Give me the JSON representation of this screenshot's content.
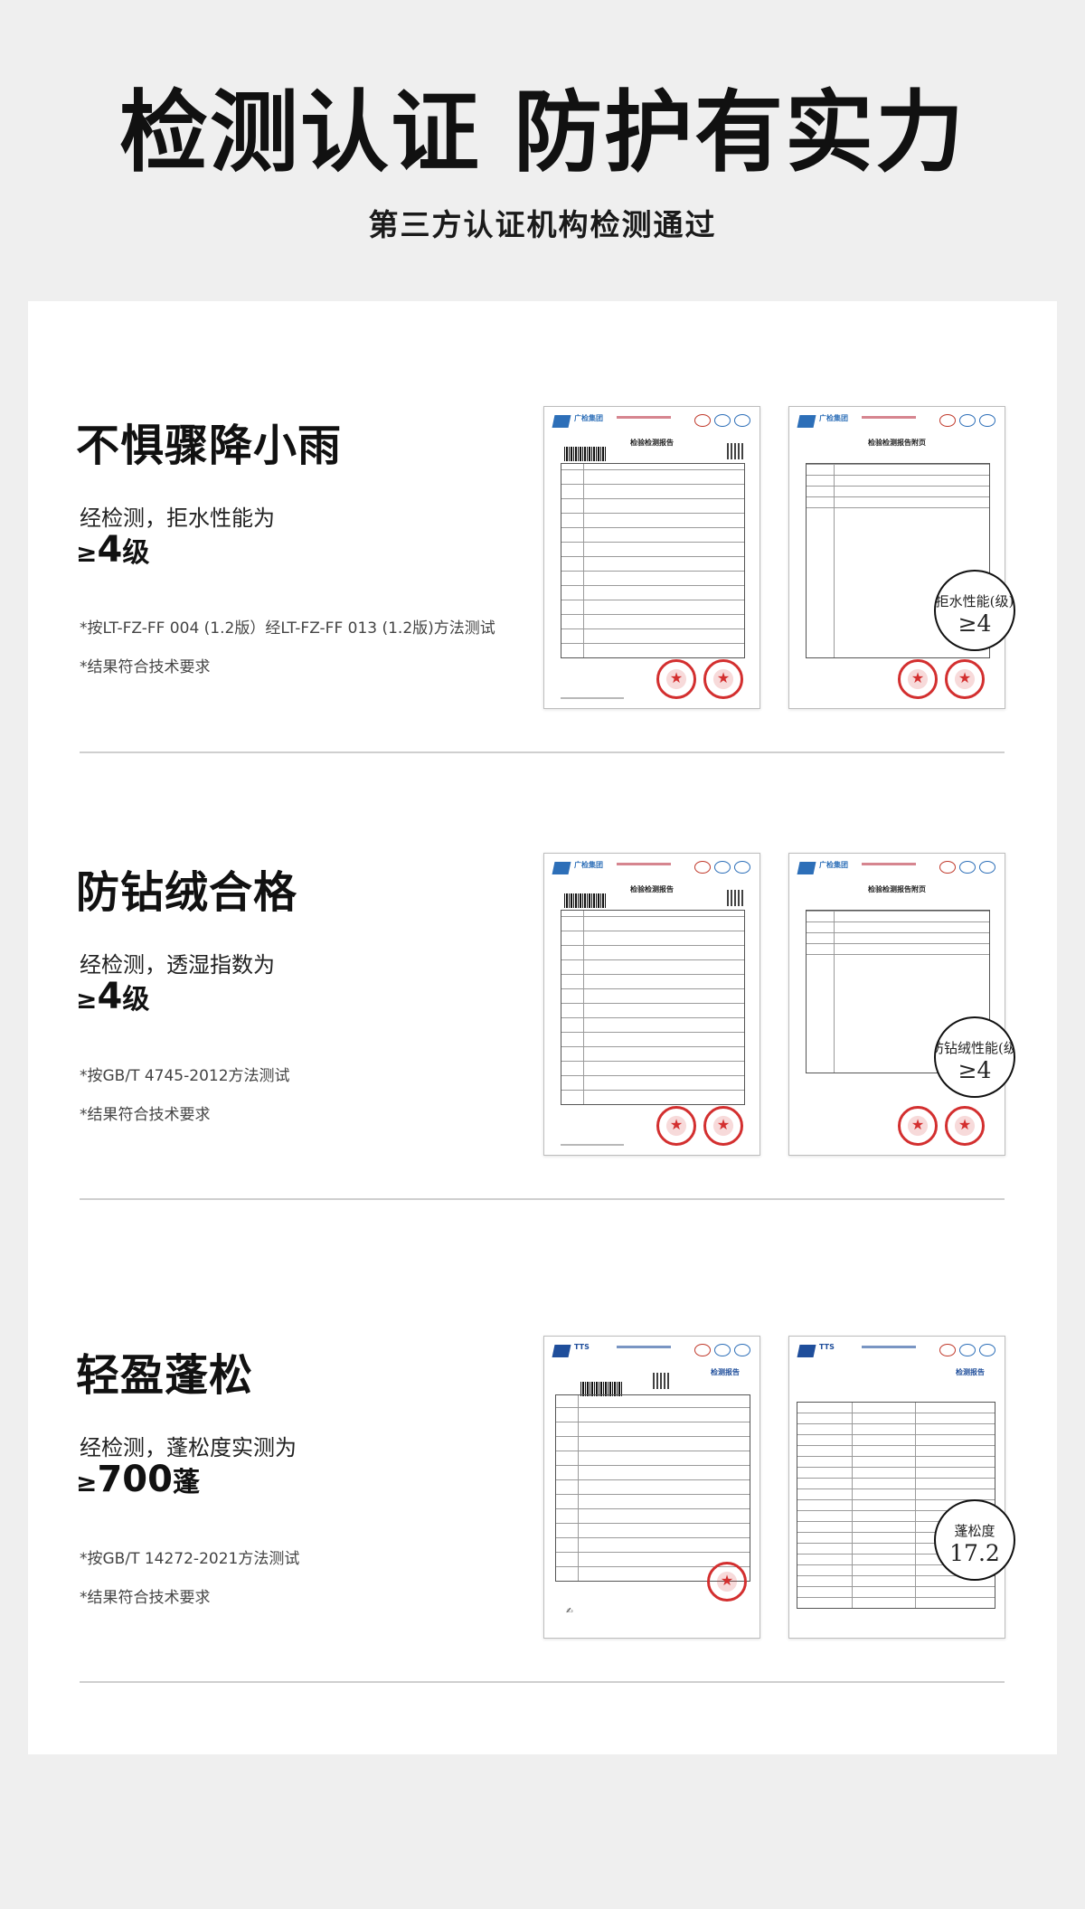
{
  "hero": {
    "title": "检测认证 防护有实力",
    "subtitle": "第三方认证机构检测通过"
  },
  "sections": [
    {
      "title": "不惧骤降小雨",
      "desc": "经检测，拒水性能为",
      "value_prefix": "≥",
      "value": "4",
      "unit": "级",
      "note1": "*按LT-FZ-FF 004 (1.2版）经LT-FZ-FF 013 (1.2版)方法测试",
      "note2": "*结果符合技术要求",
      "doc1": {
        "org": "广检集团",
        "title": "检验检测报告"
      },
      "doc2": {
        "org": "广检集团",
        "title": "检验检测报告附页"
      },
      "bubble_label": "拒水性能(级)",
      "bubble_value": "≥4"
    },
    {
      "title": "防钻绒合格",
      "desc": "经检测，透湿指数为",
      "value_prefix": "≥",
      "value": "4",
      "unit": "级",
      "note1": "*按GB/T 4745-2012方法测试",
      "note2": "*结果符合技术要求",
      "doc1": {
        "org": "广检集团",
        "title": "检验检测报告"
      },
      "doc2": {
        "org": "广检集团",
        "title": "检验检测报告附页"
      },
      "bubble_label": "防钻绒性能(级)",
      "bubble_value": "≥4"
    },
    {
      "title": "轻盈蓬松",
      "desc": "经检测，蓬松度实测为",
      "value_prefix": "≥",
      "value": "700",
      "unit": "蓬",
      "note1": "*按GB/T 14272-2021方法测试",
      "note2": "*结果符合技术要求",
      "doc1": {
        "org": "TTS",
        "title": "检测报告"
      },
      "doc2": {
        "org": "TTS",
        "title": "检测报告"
      },
      "bubble_label": "蓬松度",
      "bubble_value": "17.2"
    }
  ]
}
